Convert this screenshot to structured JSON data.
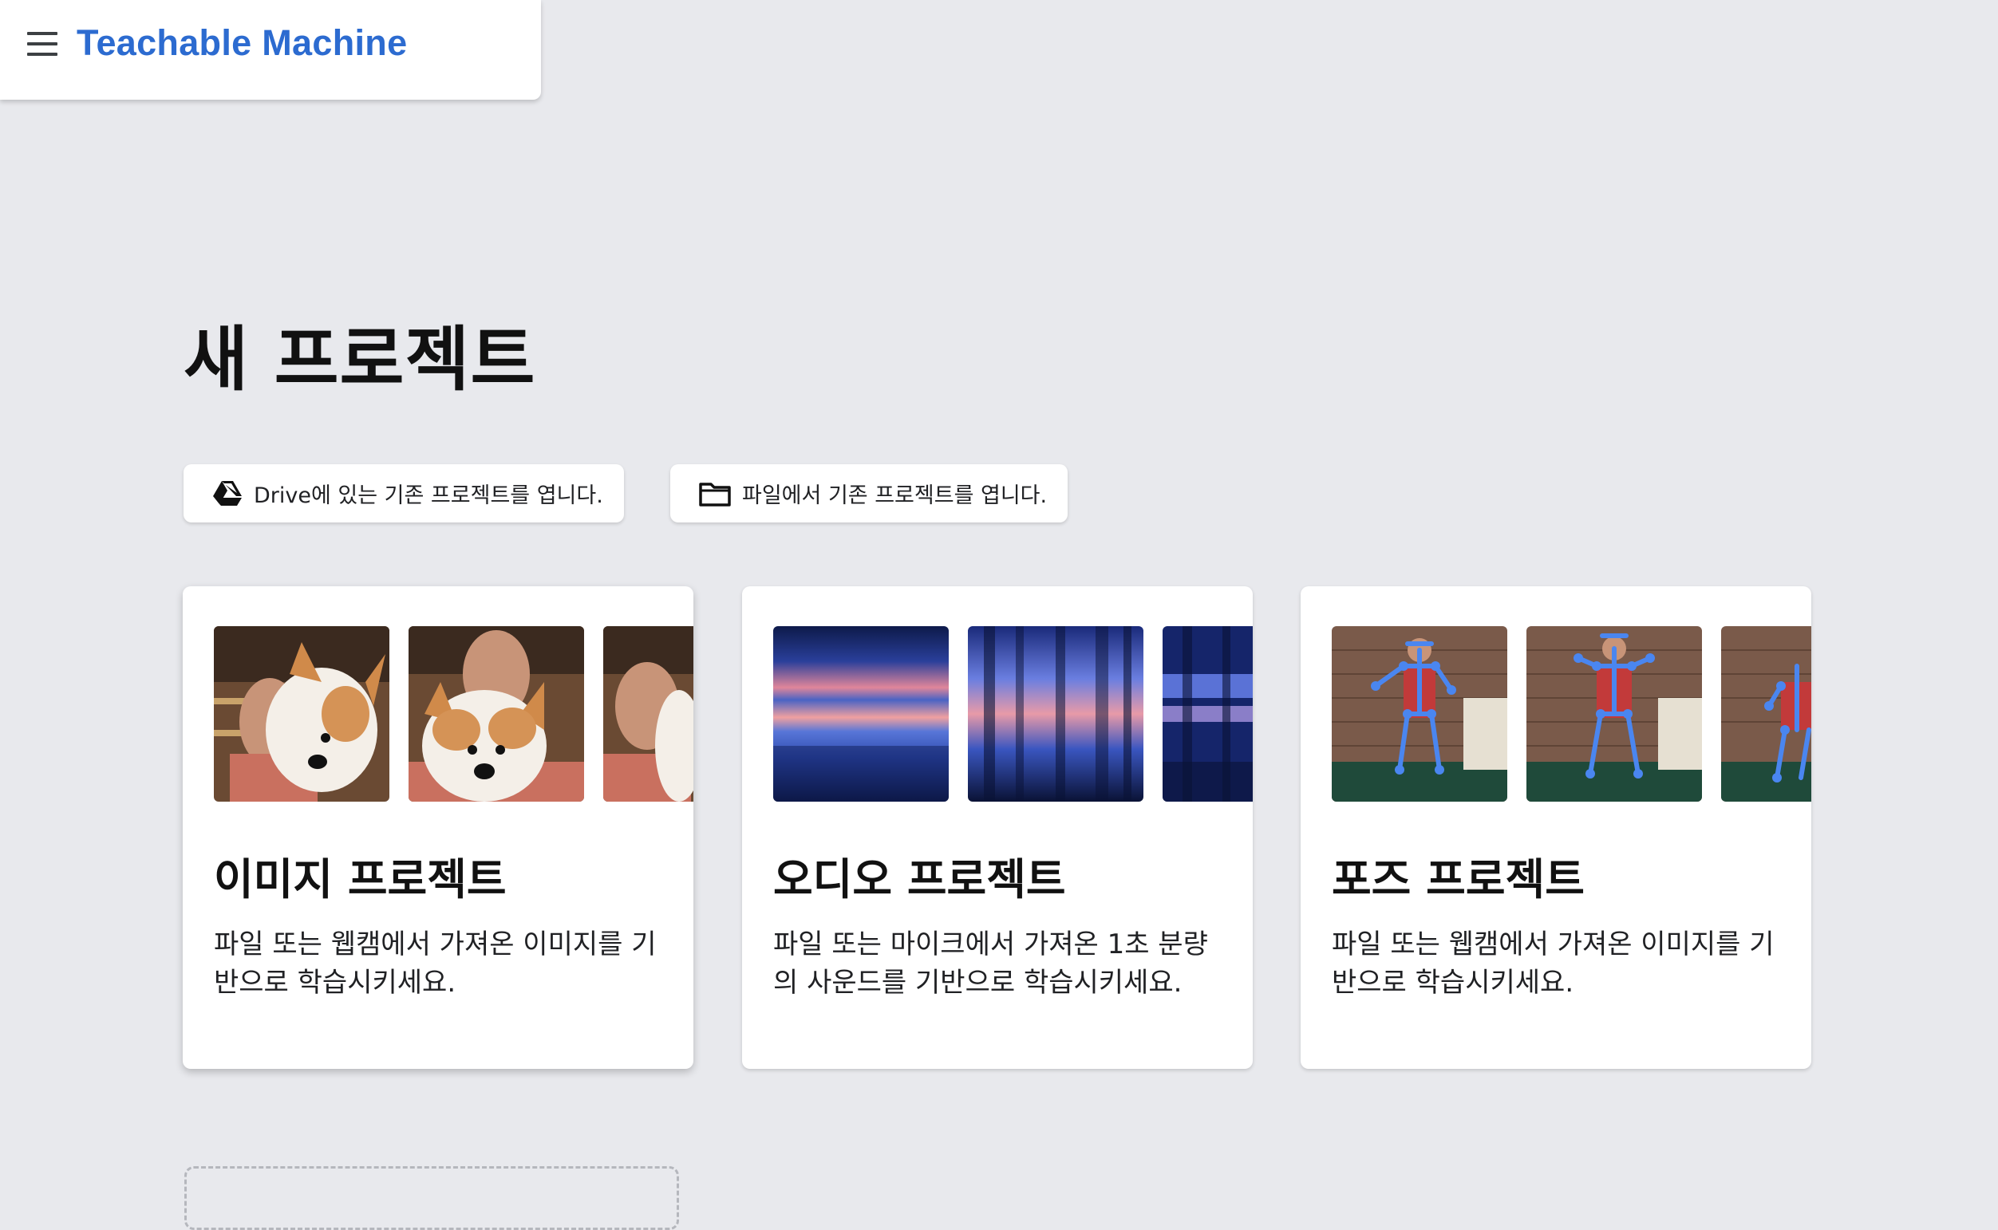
{
  "header": {
    "brand": "Teachable Machine"
  },
  "main": {
    "title": "새 프로젝트",
    "open_drive_label": "Drive에 있는 기존 프로젝트를 엽니다.",
    "open_file_label": "파일에서 기존 프로젝트를 엽니다."
  },
  "cards": {
    "image": {
      "title": "이미지 프로젝트",
      "description": "파일 또는 웹캠에서 가져온 이미지를 기반으로 학습시키세요."
    },
    "audio": {
      "title": "오디오 프로젝트",
      "description": "파일 또는 마이크에서 가져온 1초 분량의 사운드를 기반으로 학습시키세요."
    },
    "pose": {
      "title": "포즈 프로젝트",
      "description": "파일 또는 웹캠에서 가져온 이미지를 기반으로 학습시키세요."
    }
  },
  "icons": {
    "menu": "hamburger-menu-icon",
    "drive": "google-drive-icon",
    "folder": "folder-icon"
  },
  "colors": {
    "brand": "#2c6bd0",
    "background": "#e8e9ed",
    "card": "#ffffff"
  }
}
